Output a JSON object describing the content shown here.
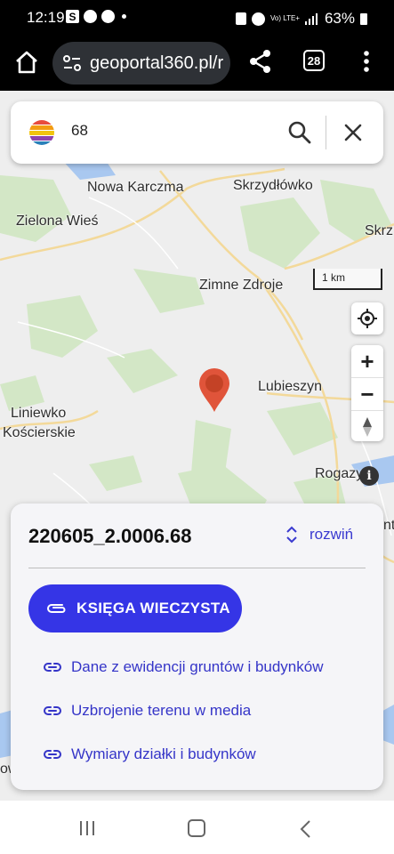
{
  "status_bar": {
    "time": "12:19",
    "network_label": "Vo) LTE+",
    "battery": "63%"
  },
  "browser": {
    "url": "geoportal360.pl/r",
    "tab_count": "28"
  },
  "search": {
    "value": "68"
  },
  "map": {
    "places": [
      "Nowa Karczma",
      "Skrzydłówko",
      "Zielona Wieś",
      "Skrz",
      "Zimne Zdroje",
      "Lubieszyn",
      "Liniewko",
      "Kościerskie",
      "Rogazy",
      "nty",
      "ow"
    ],
    "scale": "1 km"
  },
  "panel": {
    "parcel_id": "220605_2.0006.68",
    "expand_label": "rozwiń",
    "primary_button": "KSIĘGA WIECZYSTA",
    "links": [
      "Dane z ewidencji gruntów i budynków",
      "Uzbrojenie terenu w media",
      "Wymiary działki i budynków"
    ]
  },
  "colors": {
    "accent": "#3535e6",
    "pin": "#e0543a"
  }
}
